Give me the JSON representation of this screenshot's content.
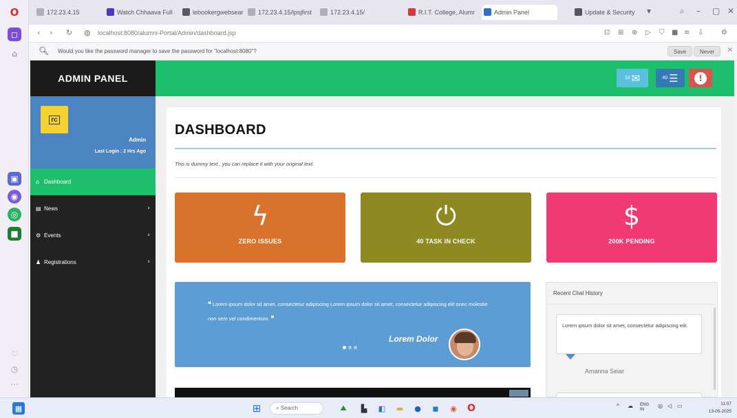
{
  "browser": {
    "tabs": [
      {
        "label": "172.23.4.15",
        "color": "#b0b0b0"
      },
      {
        "label": "Watch Chhaava Full mo",
        "color": "#4a3ac8"
      },
      {
        "label": "lebookergwebsearcom",
        "color": "#5a5a5a"
      },
      {
        "label": "172.23.4.15/lpsjfirst",
        "color": "#b0b0b0"
      },
      {
        "label": "172.23.4.15/",
        "color": "#b0b0b0"
      },
      {
        "label": "R.I.T. College, Alumni",
        "color": "#d23b3b"
      },
      {
        "label": "Admin Panel",
        "color": "#2f6fd0"
      },
      {
        "label": "Update & Security",
        "color": "#555555"
      }
    ],
    "address": "localhost:8080/alumni-Portal/Admin/dashboard.jsp",
    "password_prompt": "Would you like the password manager to save the password for \"localhost:8080\"?",
    "save_label": "Save",
    "never_label": "Never"
  },
  "admin": {
    "brand": "ADMIN PANEL",
    "logo_text": "rc",
    "user_name": "Admin",
    "last_login": "Last Login : 2 Hrs Ago",
    "menu": [
      {
        "label": "Dashboard",
        "icon": "home-icon",
        "glyph": "⌂",
        "has_chevron": false,
        "active": true
      },
      {
        "label": "News",
        "icon": "list-icon",
        "glyph": "▤",
        "has_chevron": true,
        "active": false
      },
      {
        "label": "Events",
        "icon": "gear-icon",
        "glyph": "⚙",
        "has_chevron": true,
        "active": false
      },
      {
        "label": "Registrations",
        "icon": "user-icon",
        "glyph": "♟",
        "has_chevron": true,
        "active": false
      }
    ],
    "top_buttons": [
      {
        "count": "10",
        "icon": "envelope-icon",
        "glyph": "✉",
        "color": "#5bc0de"
      },
      {
        "count": "40",
        "icon": "bars-icon",
        "glyph": "☰",
        "color": "#337ab7"
      },
      {
        "count": "",
        "icon": "alert-icon",
        "glyph": "!",
        "color": "#d9534f"
      }
    ]
  },
  "dashboard": {
    "title": "DASHBOARD",
    "subtitle": "This is dummy text , you can replace it with your original text.",
    "stats": [
      {
        "label": "ZERO ISSUES",
        "icon": "lightning-icon",
        "glyph": "ϟ",
        "color": "#d9722b"
      },
      {
        "label": "40 TASK IN CHECK",
        "icon": "plug-icon",
        "glyph": "⏻",
        "color": "#8e8a21"
      },
      {
        "label": "200K PENDING",
        "icon": "dollar-icon",
        "glyph": "$",
        "color": "#f13a73"
      }
    ],
    "quote": {
      "text": "Lorem ipsum dolor sit amet, consectetur adipiscing Lorem ipsum dolor sit amet, consectetur adipiscing elit onec molestie non sem vel condimentum.",
      "author": "Lorem Dolor",
      "slides": 3,
      "active_slide": 1
    },
    "chat": {
      "title": "Recent Chat History",
      "message": "Lorem ipsum dolor sit amet, consectetur adipiscing elit.",
      "sender": "Amanna Seiar"
    }
  },
  "taskbar": {
    "search_placeholder": "Search",
    "lang": "ENG IN",
    "time": "11:07",
    "date": "13-05-2025"
  }
}
